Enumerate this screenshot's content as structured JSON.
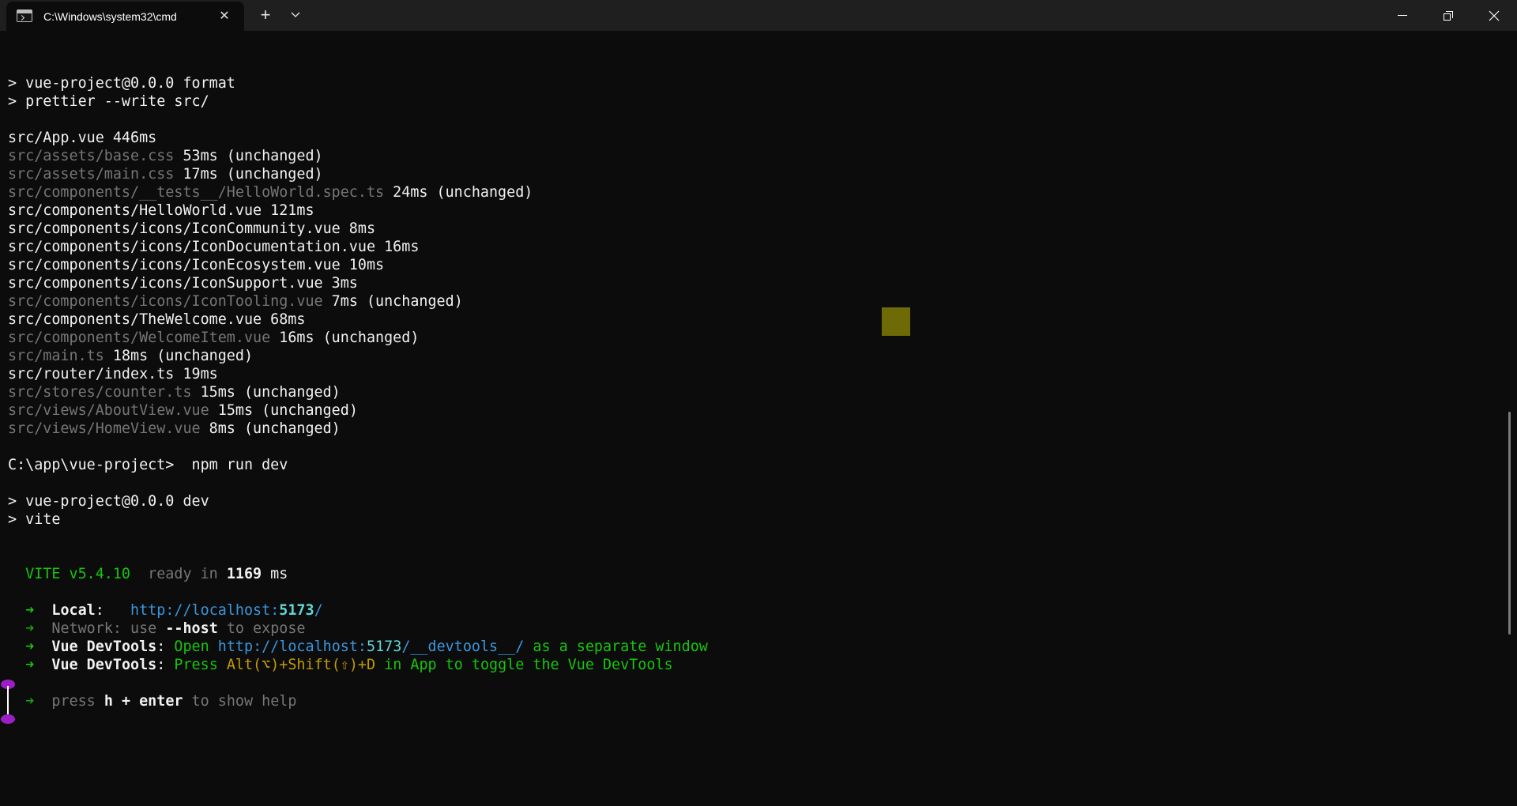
{
  "window": {
    "tab_title": "C:\\Windows\\system32\\cmd",
    "tab_close": "✕",
    "new_tab": "+",
    "tab_dropdown": "⌄"
  },
  "terminal": {
    "lines": [
      {
        "segments": []
      },
      {
        "segments": [
          {
            "t": "> vue-project@0.0.0 format",
            "c": "white"
          }
        ]
      },
      {
        "segments": [
          {
            "t": "> prettier --write src/",
            "c": "white"
          }
        ]
      },
      {
        "segments": []
      },
      {
        "segments": [
          {
            "t": "src/App.vue 446ms",
            "c": "white"
          }
        ]
      },
      {
        "segments": [
          {
            "t": "src/assets/base.css",
            "c": "dim"
          },
          {
            "t": " 53ms (unchanged)",
            "c": "white"
          }
        ]
      },
      {
        "segments": [
          {
            "t": "src/assets/main.css",
            "c": "dim"
          },
          {
            "t": " 17ms (unchanged)",
            "c": "white"
          }
        ]
      },
      {
        "segments": [
          {
            "t": "src/components/__tests__/HelloWorld.spec.ts",
            "c": "dim"
          },
          {
            "t": " 24ms (unchanged)",
            "c": "white"
          }
        ]
      },
      {
        "segments": [
          {
            "t": "src/components/HelloWorld.vue 121ms",
            "c": "white"
          }
        ]
      },
      {
        "segments": [
          {
            "t": "src/components/icons/IconCommunity.vue 8ms",
            "c": "white"
          }
        ]
      },
      {
        "segments": [
          {
            "t": "src/components/icons/IconDocumentation.vue 16ms",
            "c": "white"
          }
        ]
      },
      {
        "segments": [
          {
            "t": "src/components/icons/IconEcosystem.vue 10ms",
            "c": "white"
          }
        ]
      },
      {
        "segments": [
          {
            "t": "src/components/icons/IconSupport.vue 3ms",
            "c": "white"
          }
        ]
      },
      {
        "segments": [
          {
            "t": "src/components/icons/IconTooling.vue",
            "c": "dim"
          },
          {
            "t": " 7ms (unchanged)",
            "c": "white"
          }
        ]
      },
      {
        "segments": [
          {
            "t": "src/components/TheWelcome.vue 68ms",
            "c": "white"
          }
        ]
      },
      {
        "segments": [
          {
            "t": "src/components/WelcomeItem.vue",
            "c": "dim"
          },
          {
            "t": " 16ms (unchanged)",
            "c": "white"
          }
        ]
      },
      {
        "segments": [
          {
            "t": "src/main.ts",
            "c": "dim"
          },
          {
            "t": " 18ms (unchanged)",
            "c": "white"
          }
        ]
      },
      {
        "segments": [
          {
            "t": "src/router/index.ts 19ms",
            "c": "white"
          }
        ]
      },
      {
        "segments": [
          {
            "t": "src/stores/counter.ts",
            "c": "dim"
          },
          {
            "t": " 15ms (unchanged)",
            "c": "white"
          }
        ]
      },
      {
        "segments": [
          {
            "t": "src/views/AboutView.vue",
            "c": "dim"
          },
          {
            "t": " 15ms (unchanged)",
            "c": "white"
          }
        ]
      },
      {
        "segments": [
          {
            "t": "src/views/HomeView.vue",
            "c": "dim"
          },
          {
            "t": " 8ms (unchanged)",
            "c": "white"
          }
        ]
      },
      {
        "segments": []
      },
      {
        "segments": [
          {
            "t": "C:\\app\\vue-project>  npm run dev",
            "c": "white"
          }
        ]
      },
      {
        "segments": []
      },
      {
        "segments": [
          {
            "t": "> vue-project@0.0.0 dev",
            "c": "white"
          }
        ]
      },
      {
        "segments": [
          {
            "t": "> vite",
            "c": "white"
          }
        ]
      },
      {
        "segments": []
      },
      {
        "segments": []
      },
      {
        "segments": [
          {
            "t": "  VITE v5.4.10",
            "c": "green"
          },
          {
            "t": "  ready in ",
            "c": "dim"
          },
          {
            "t": "1169",
            "c": "white bold"
          },
          {
            "t": " ms",
            "c": "white"
          }
        ]
      },
      {
        "segments": []
      },
      {
        "segments": [
          {
            "t": "  ➜  ",
            "c": "green"
          },
          {
            "t": "Local",
            "c": "white bold"
          },
          {
            "t": ":   ",
            "c": "white"
          },
          {
            "t": "http://localhost:",
            "c": "cyan"
          },
          {
            "t": "5173",
            "c": "bcyan bold"
          },
          {
            "t": "/",
            "c": "cyan"
          }
        ]
      },
      {
        "segments": [
          {
            "t": "  ➜  ",
            "c": "bgreen dim"
          },
          {
            "t": "Network",
            "c": "dim"
          },
          {
            "t": ": use ",
            "c": "dim"
          },
          {
            "t": "--host",
            "c": "white bold"
          },
          {
            "t": " to expose",
            "c": "dim"
          }
        ]
      },
      {
        "segments": [
          {
            "t": "  ➜  ",
            "c": "green"
          },
          {
            "t": "Vue DevTools",
            "c": "white bold"
          },
          {
            "t": ": ",
            "c": "white"
          },
          {
            "t": "Open ",
            "c": "green"
          },
          {
            "t": "http://localhost:",
            "c": "cyan"
          },
          {
            "t": "5173",
            "c": "bcyan"
          },
          {
            "t": "/__devtools__/",
            "c": "cyan"
          },
          {
            "t": " as a separate window",
            "c": "green"
          }
        ]
      },
      {
        "segments": [
          {
            "t": "  ➜  ",
            "c": "green"
          },
          {
            "t": "Vue DevTools",
            "c": "white bold"
          },
          {
            "t": ": ",
            "c": "white"
          },
          {
            "t": "Press ",
            "c": "green"
          },
          {
            "t": "Alt(⌥)+Shift(⇧)+D",
            "c": "yellow"
          },
          {
            "t": " in App to toggle the Vue DevTools",
            "c": "green"
          }
        ]
      },
      {
        "segments": []
      },
      {
        "segments": [
          {
            "t": "  ➜  ",
            "c": "bgreen dim"
          },
          {
            "t": "press ",
            "c": "dim"
          },
          {
            "t": "h + enter",
            "c": "white bold"
          },
          {
            "t": " to show help",
            "c": "dim"
          }
        ]
      }
    ]
  },
  "colors": {
    "background": "#0c0c0c",
    "titlebar": "#1f1f1f",
    "green": "#16c60c",
    "cyan": "#3a96dd",
    "yellow": "#c19c00",
    "dim": "#767676"
  }
}
